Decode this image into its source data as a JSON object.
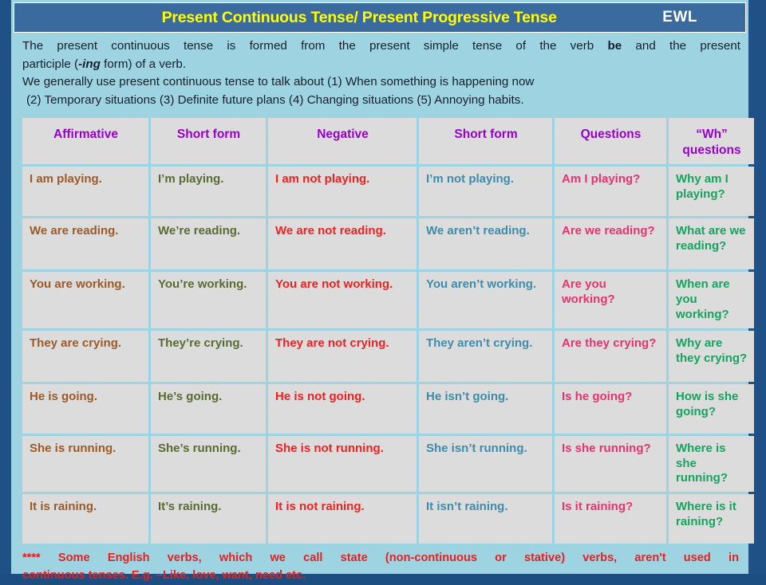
{
  "header": {
    "title": "Present Continuous Tense/ Present Progressive Tense",
    "badge": "EWL",
    "title_color": "#ffff00",
    "bar_color": "#3a6a9e"
  },
  "intro": {
    "line1_a": "The present continuous tense is formed from the present simple tense of the verb ",
    "line1_bold": "be",
    "line1_b": " and the present",
    "line2_a": "participle (",
    "line2_italic": "-ing",
    "line2_b": " form) of a verb.",
    "line3": "We generally use present continuous tense to talk about (1) When something is happening now",
    "line4": " (2) Temporary situations  (3) Definite future plans (4) Changing situations (5) Annoying habits.",
    "background": "#9ed4e2"
  },
  "table": {
    "headers": [
      "Affirmative",
      "Short form",
      "Negative",
      "Short form",
      "Questions",
      "“Wh” questions"
    ],
    "header_color": "#9900cc",
    "column_colors": [
      "#9b5a28",
      "#5a6b32",
      "#ee2222",
      "#3e8cab",
      "#e8336e",
      "#16a360"
    ],
    "cell_background": "#dcdcdc",
    "rows": [
      {
        "affirmative": "I am playing.",
        "short_form": "I’m playing.",
        "negative": "I am not playing.",
        "short_negative": "I’m not playing.",
        "question": "Am I playing?",
        "wh_question": "Why am I playing?"
      },
      {
        "affirmative": "We are reading.",
        "short_form": "We’re reading.",
        "negative": "We are not reading.",
        "short_negative": "We aren’t reading.",
        "question": "Are we reading?",
        "wh_question": "What are we reading?"
      },
      {
        "affirmative": "You are working.",
        "short_form": "You’re working.",
        "negative": "You are not working.",
        "short_negative": "You aren’t working.",
        "question": "Are you working?",
        "wh_question": "When are you working?"
      },
      {
        "affirmative": "They are crying.",
        "short_form": "They’re crying.",
        "negative": "They are not crying.",
        "short_negative": "They aren’t crying.",
        "question": "Are they crying?",
        "wh_question": "Why are they crying?"
      },
      {
        "affirmative": "He is going.",
        "short_form": "He’s going.",
        "negative": "He is not going.",
        "short_negative": "He isn’t going.",
        "question": "Is he going?",
        "wh_question": "How is she going?"
      },
      {
        "affirmative": "She is running.",
        "short_form": "She’s running.",
        "negative": "She is not running.",
        "short_negative": "She isn’t running.",
        "question": "Is she running?",
        "wh_question": "Where is she running?"
      },
      {
        "affirmative": "It is raining.",
        "short_form": "It’s raining.",
        "negative": "It is not raining.",
        "short_negative": "It isn’t raining.",
        "question": "Is it raining?",
        "wh_question": "Where is it raining?"
      }
    ]
  },
  "note": {
    "line1": "**** Some English verbs, which we call state (non-continuous or stative) verbs, aren't used in",
    "line2": "continuous tenses. E.g. –Like, love, want, need etc.",
    "color": "#e52222"
  }
}
